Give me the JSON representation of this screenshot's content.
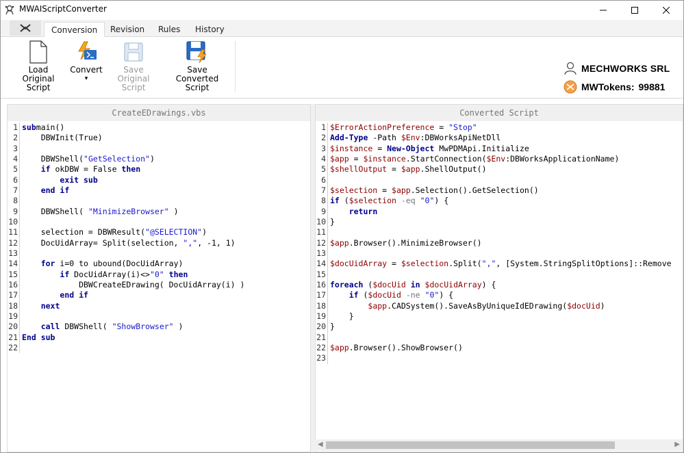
{
  "window": {
    "title": "MWAIScriptConverter"
  },
  "tabs": [
    {
      "label": "Conversion",
      "active": true
    },
    {
      "label": "Revision"
    },
    {
      "label": "Rules"
    },
    {
      "label": "History"
    }
  ],
  "ribbon": {
    "load": {
      "line1": "Load",
      "line2": "Original Script"
    },
    "convert": {
      "line1": "Convert",
      "line2": "▾"
    },
    "save_original": {
      "line1": "Save",
      "line2": "Original Script",
      "disabled": true
    },
    "save_converted": {
      "line1": "Save",
      "line2": "Converted Script"
    }
  },
  "account": {
    "company": "MECHWORKS SRL",
    "tokens_label": "MWTokens:",
    "tokens_value": "99881"
  },
  "colors": {
    "keyword": "#00008b",
    "string": "#1818d0",
    "variable": "#8b0000"
  },
  "left_pane": {
    "title": "CreateEDrawings.vbs",
    "lines": [
      {
        "n": "1",
        "segs": [
          [
            "kw",
            "sub"
          ],
          [
            "",
            "main()"
          ]
        ]
      },
      {
        "n": "2",
        "segs": [
          [
            "",
            "    DBWInit(True)"
          ]
        ]
      },
      {
        "n": "3",
        "segs": []
      },
      {
        "n": "4",
        "segs": [
          [
            "",
            "    DBWShell("
          ],
          [
            "str",
            "\"GetSelection\""
          ],
          [
            "",
            ")"
          ]
        ]
      },
      {
        "n": "5",
        "segs": [
          [
            "",
            "    "
          ],
          [
            "kw",
            "if"
          ],
          [
            "",
            " okDBW = False "
          ],
          [
            "kw",
            "then"
          ]
        ]
      },
      {
        "n": "6",
        "segs": [
          [
            "",
            "        "
          ],
          [
            "kw",
            "exit sub"
          ]
        ]
      },
      {
        "n": "7",
        "segs": [
          [
            "",
            "    "
          ],
          [
            "kw",
            "end if"
          ]
        ]
      },
      {
        "n": "8",
        "segs": []
      },
      {
        "n": "9",
        "segs": [
          [
            "",
            "    DBWShell( "
          ],
          [
            "str",
            "\"MinimizeBrowser\""
          ],
          [
            "",
            " )"
          ]
        ]
      },
      {
        "n": "10",
        "segs": []
      },
      {
        "n": "11",
        "segs": [
          [
            "",
            "    selection = DBWResult("
          ],
          [
            "str",
            "\"@SELECTION\""
          ],
          [
            "",
            ")"
          ]
        ]
      },
      {
        "n": "12",
        "segs": [
          [
            "",
            "    DocUidArray= Split(selection, "
          ],
          [
            "str",
            "\",\""
          ],
          [
            "",
            ", -1, 1)"
          ]
        ]
      },
      {
        "n": "13",
        "segs": []
      },
      {
        "n": "14",
        "segs": [
          [
            "",
            "    "
          ],
          [
            "kw",
            "for"
          ],
          [
            "",
            " i=0 to ubound(DocUidArray)"
          ]
        ]
      },
      {
        "n": "15",
        "segs": [
          [
            "",
            "        "
          ],
          [
            "kw",
            "if"
          ],
          [
            "",
            " DocUidArray(i)<>"
          ],
          [
            "str",
            "\"0\""
          ],
          [
            "",
            " "
          ],
          [
            "kw",
            "then"
          ]
        ]
      },
      {
        "n": "16",
        "segs": [
          [
            "",
            "            DBWCreateEDrawing( DocUidArray(i) )"
          ]
        ]
      },
      {
        "n": "17",
        "segs": [
          [
            "",
            "        "
          ],
          [
            "kw",
            "end if"
          ]
        ]
      },
      {
        "n": "18",
        "segs": [
          [
            "",
            "    "
          ],
          [
            "kw",
            "next"
          ]
        ]
      },
      {
        "n": "19",
        "segs": []
      },
      {
        "n": "20",
        "segs": [
          [
            "",
            "    "
          ],
          [
            "kw",
            "call"
          ],
          [
            "",
            " DBWShell( "
          ],
          [
            "str",
            "\"ShowBrowser\""
          ],
          [
            "",
            " )"
          ]
        ]
      },
      {
        "n": "21",
        "segs": [
          [
            "kw",
            "End sub"
          ]
        ]
      },
      {
        "n": "22",
        "segs": []
      }
    ]
  },
  "right_pane": {
    "title": "Converted Script",
    "lines": [
      {
        "n": "1",
        "segs": [
          [
            "var",
            "$ErrorActionPreference"
          ],
          [
            "",
            " = "
          ],
          [
            "str",
            "\"Stop\""
          ]
        ]
      },
      {
        "n": "2",
        "segs": [
          [
            "kw",
            "Add-Type"
          ],
          [
            "",
            " -Path "
          ],
          [
            "var",
            "$Env"
          ],
          [
            "",
            ":DBWorksApiNetDll"
          ]
        ]
      },
      {
        "n": "3",
        "segs": [
          [
            "var",
            "$instance"
          ],
          [
            "",
            " = "
          ],
          [
            "kw",
            "New-Object"
          ],
          [
            "",
            " MwPDMApi.Initialize"
          ]
        ]
      },
      {
        "n": "4",
        "segs": [
          [
            "var",
            "$app"
          ],
          [
            "",
            " = "
          ],
          [
            "var",
            "$instance"
          ],
          [
            "",
            ".StartConnection("
          ],
          [
            "var",
            "$Env"
          ],
          [
            "",
            ":DBWorksApplicationName)"
          ]
        ]
      },
      {
        "n": "5",
        "segs": [
          [
            "var",
            "$shellOutput"
          ],
          [
            "",
            " = "
          ],
          [
            "var",
            "$app"
          ],
          [
            "",
            ".ShellOutput()"
          ]
        ]
      },
      {
        "n": "6",
        "segs": []
      },
      {
        "n": "7",
        "segs": [
          [
            "var",
            "$selection"
          ],
          [
            "",
            " = "
          ],
          [
            "var",
            "$app"
          ],
          [
            "",
            ".Selection().GetSelection()"
          ]
        ]
      },
      {
        "n": "8",
        "segs": [
          [
            "kw",
            "if"
          ],
          [
            "",
            " ("
          ],
          [
            "var",
            "$selection"
          ],
          [
            "",
            " "
          ],
          [
            "op",
            "-eq"
          ],
          [
            "",
            " "
          ],
          [
            "str",
            "\"0\""
          ],
          [
            "",
            ") {"
          ]
        ]
      },
      {
        "n": "9",
        "segs": [
          [
            "",
            "    "
          ],
          [
            "kw",
            "return"
          ]
        ]
      },
      {
        "n": "10",
        "segs": [
          [
            "",
            "}"
          ]
        ]
      },
      {
        "n": "11",
        "segs": []
      },
      {
        "n": "12",
        "segs": [
          [
            "var",
            "$app"
          ],
          [
            "",
            ".Browser().MinimizeBrowser()"
          ]
        ]
      },
      {
        "n": "13",
        "segs": []
      },
      {
        "n": "14",
        "segs": [
          [
            "var",
            "$docUidArray"
          ],
          [
            "",
            " = "
          ],
          [
            "var",
            "$selection"
          ],
          [
            "",
            ".Split("
          ],
          [
            "str",
            "\",\""
          ],
          [
            "",
            ", [System.StringSplitOptions]::Remove"
          ]
        ]
      },
      {
        "n": "15",
        "segs": []
      },
      {
        "n": "16",
        "segs": [
          [
            "kw",
            "foreach"
          ],
          [
            "",
            " ("
          ],
          [
            "var",
            "$docUid"
          ],
          [
            "",
            " "
          ],
          [
            "kw",
            "in"
          ],
          [
            "",
            " "
          ],
          [
            "var",
            "$docUidArray"
          ],
          [
            "",
            ") {"
          ]
        ]
      },
      {
        "n": "17",
        "segs": [
          [
            "",
            "    "
          ],
          [
            "kw",
            "if"
          ],
          [
            "",
            " ("
          ],
          [
            "var",
            "$docUid"
          ],
          [
            "",
            " "
          ],
          [
            "op",
            "-ne"
          ],
          [
            "",
            " "
          ],
          [
            "str",
            "\"0\""
          ],
          [
            "",
            ") {"
          ]
        ]
      },
      {
        "n": "18",
        "segs": [
          [
            "",
            "        "
          ],
          [
            "var",
            "$app"
          ],
          [
            "",
            ".CADSystem().SaveAsByUniqueIdEDrawing("
          ],
          [
            "var",
            "$docUid"
          ],
          [
            "",
            ")"
          ]
        ]
      },
      {
        "n": "19",
        "segs": [
          [
            "",
            "    }"
          ]
        ]
      },
      {
        "n": "20",
        "segs": [
          [
            "",
            "}"
          ]
        ]
      },
      {
        "n": "21",
        "segs": []
      },
      {
        "n": "22",
        "segs": [
          [
            "var",
            "$app"
          ],
          [
            "",
            ".Browser().ShowBrowser()"
          ]
        ]
      },
      {
        "n": "23",
        "segs": []
      }
    ]
  }
}
